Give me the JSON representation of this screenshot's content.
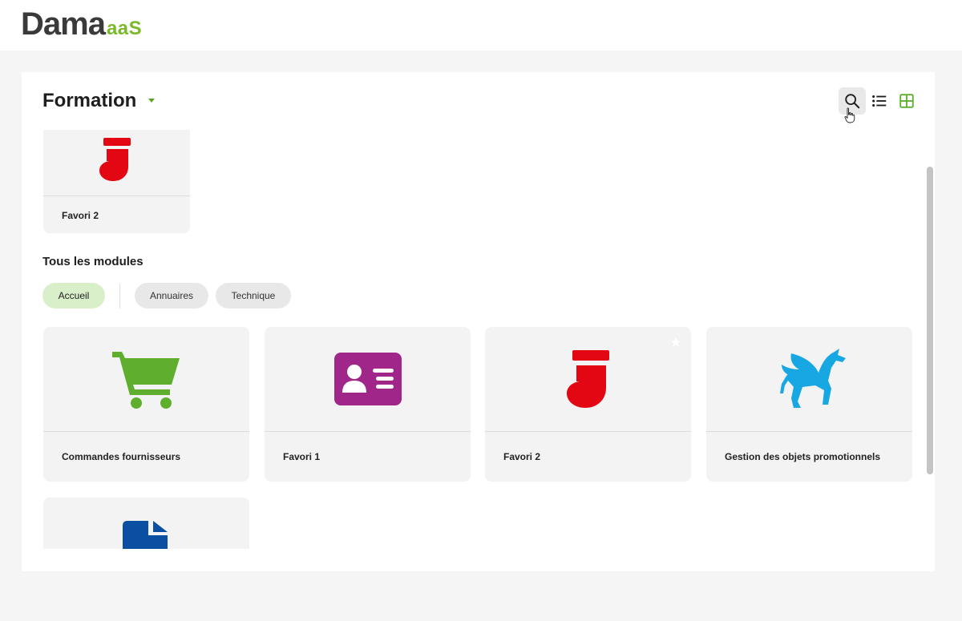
{
  "app": {
    "logo_main": "Dama",
    "logo_suffix": "aaS"
  },
  "header": {
    "title": "Formation"
  },
  "toolbar": {
    "search_icon": "search-icon",
    "list_icon": "list-view-icon",
    "grid_icon": "grid-view-icon",
    "active_view": "grid"
  },
  "favorites": [
    {
      "label": "Favori 2",
      "icon": "stocking-icon",
      "color": "#e30613"
    }
  ],
  "modules": {
    "section_title": "Tous les modules",
    "filters": [
      {
        "label": "Accueil",
        "active": true
      },
      {
        "label": "Annuaires",
        "active": false
      },
      {
        "label": "Technique",
        "active": false
      }
    ],
    "cards": [
      {
        "label": "Commandes fournisseurs",
        "icon": "shopping-cart-icon",
        "color": "#5fae2e"
      },
      {
        "label": "Favori 1",
        "icon": "id-card-icon",
        "color": "#a0268a"
      },
      {
        "label": "Favori 2",
        "icon": "stocking-icon",
        "color": "#e30613"
      },
      {
        "label": "Gestion des objets promotionnels",
        "icon": "pegasus-icon",
        "color": "#17a7e3"
      },
      {
        "label": "",
        "icon": "document-icon",
        "color": "#0b4fa3"
      }
    ]
  },
  "colors": {
    "brand_dark": "#3a3a3a",
    "brand_green": "#7ab929",
    "chip_active_bg": "#d9efca"
  }
}
